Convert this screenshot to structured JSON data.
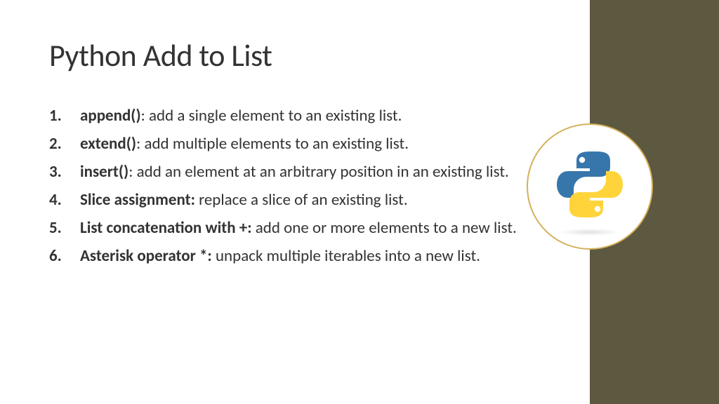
{
  "title": "Python Add to List",
  "items": [
    {
      "term": "append()",
      "sep": ": ",
      "desc": "add a single element to an existing list."
    },
    {
      "term": "extend()",
      "sep": ": ",
      "desc": "add multiple elements to an existing list."
    },
    {
      "term": "insert()",
      "sep": ": ",
      "desc": "add an element at an arbitrary position in an existing list."
    },
    {
      "term": "Slice assignment:",
      "sep": " ",
      "desc": "replace a slice of an existing list."
    },
    {
      "term": "List concatenation with +:",
      "sep": " ",
      "desc": "add one or more elements to a new list."
    },
    {
      "term": "Asterisk operator *:",
      "sep": " ",
      "desc": "unpack multiple iterables into a new list."
    }
  ],
  "logo_alt": "python-logo",
  "colors": {
    "sidebar": "#5d5840",
    "logo_border": "#d4b05a",
    "python_blue": "#3776AB",
    "python_yellow": "#FFD43B"
  }
}
